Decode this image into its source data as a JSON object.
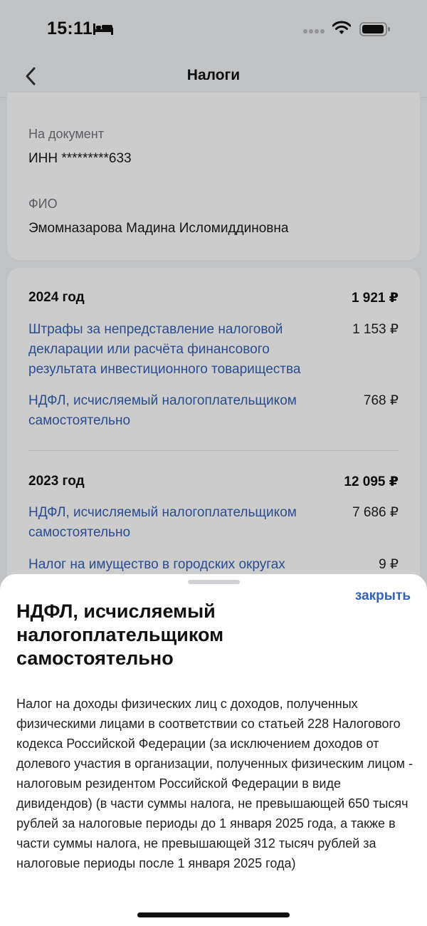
{
  "status_bar": {
    "time": "15:11",
    "icons": [
      "bed-icon",
      "signal-icon",
      "wifi-icon",
      "battery-icon"
    ]
  },
  "nav": {
    "title": "Налоги",
    "back_icon": "chevron-left-icon"
  },
  "document": {
    "doc_label": "На документ",
    "doc_value": "ИНН *********633",
    "fio_label": "ФИО",
    "fio_value": "Эмомназарова Мадина Исломиддиновна"
  },
  "years": [
    {
      "year": "2024 год",
      "total": "1 921 ₽",
      "items": [
        {
          "name": "Штрафы за непредставление налоговой декларации или расчёта финансового результата инвестиционного товарищества",
          "amount": "1 153 ₽"
        },
        {
          "name": "НДФЛ, исчисляемый налогоплательщиком самостоятельно",
          "amount": "768 ₽"
        }
      ]
    },
    {
      "year": "2023 год",
      "total": "12 095 ₽",
      "items": [
        {
          "name": "НДФЛ, исчисляемый налогоплательщиком самостоятельно",
          "amount": "7 686 ₽"
        },
        {
          "name": "Налог на имущество в городских округах",
          "amount": "9 ₽"
        }
      ]
    }
  ],
  "sheet": {
    "close_label": "закрыть",
    "title": "НДФЛ, исчисляемый налогоплательщиком самостоятельно",
    "body": "Налог на доходы физических лиц с доходов, полученных физическими лицами в соответствии со статьей 228 Налогового кодекса Российской Федерации (за исключением доходов от долевого участия в организации, полученных физическим лицом - налоговым резидентом Российской Федерации в виде дивидендов) (в части суммы налога, не превышающей 650 тысяч рублей за налоговые периоды до 1 января 2025 года, а также в части суммы налога, не превышающей 312 тысяч рублей за налоговые периоды после 1 января 2025 года)"
  },
  "colors": {
    "link": "#3461b4",
    "background": "#f2f3f5",
    "card": "#ffffff"
  }
}
